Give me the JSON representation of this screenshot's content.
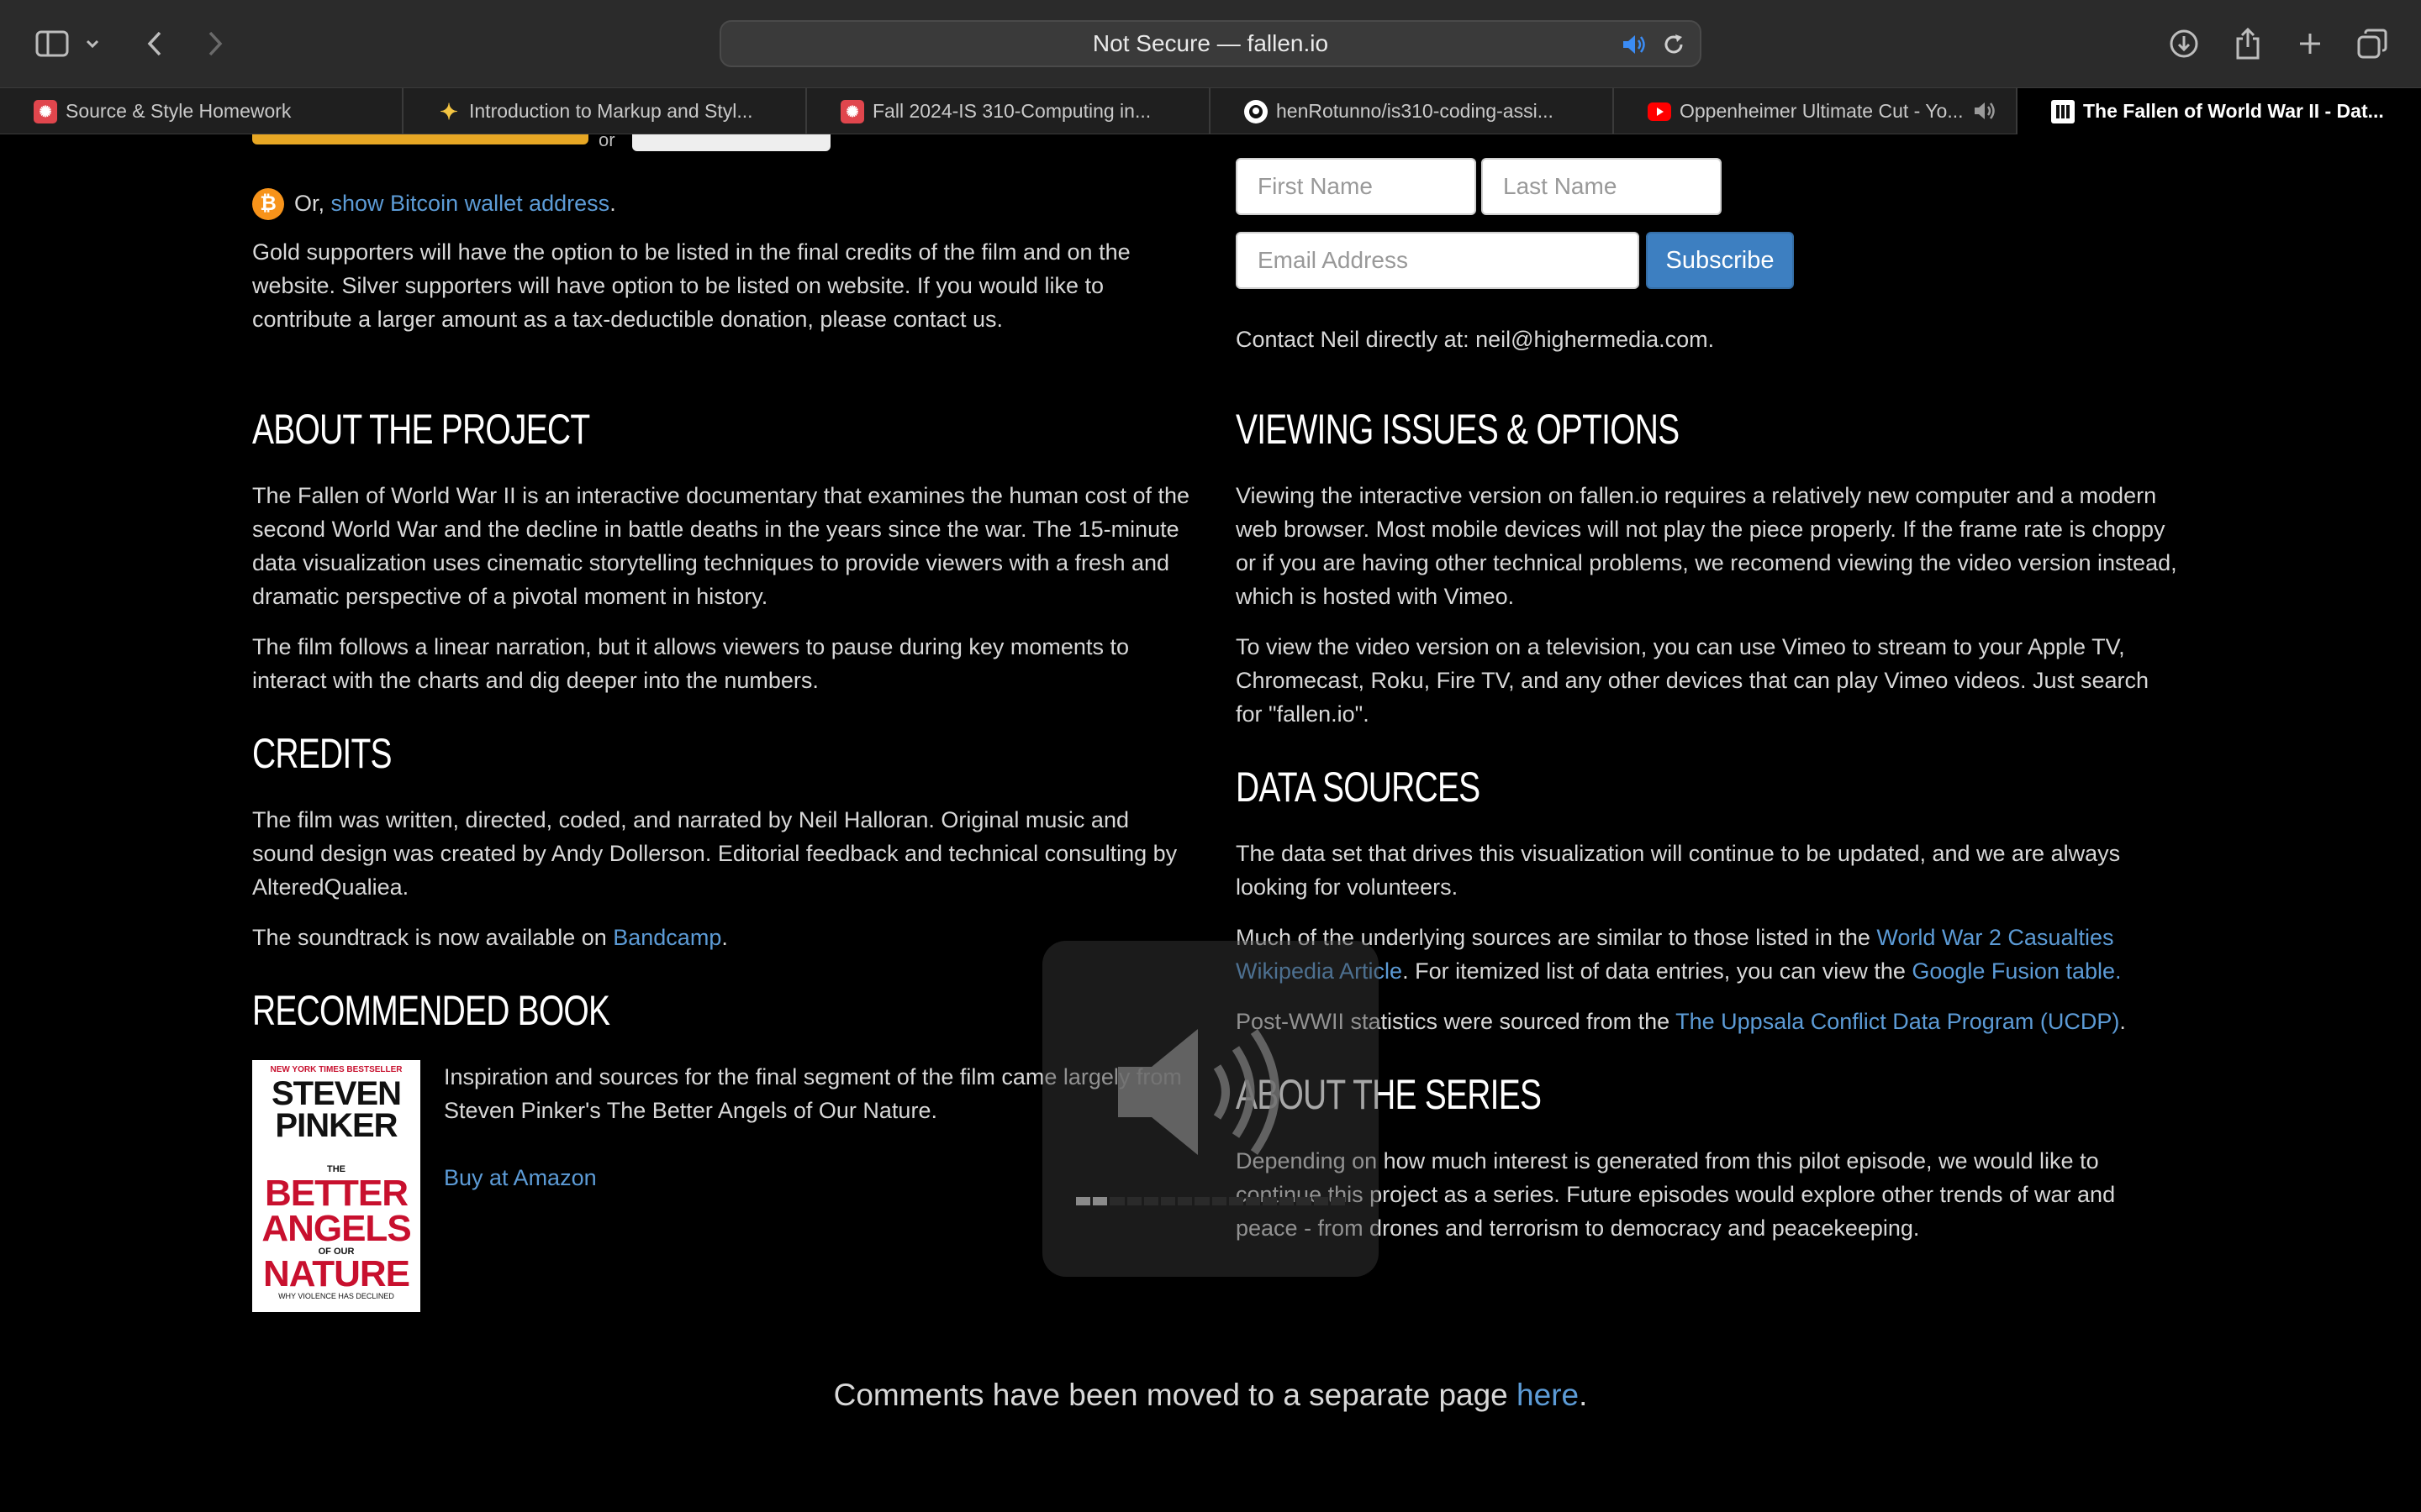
{
  "browser": {
    "address": "Not Secure — fallen.io",
    "tabs": [
      {
        "label": "Source & Style Homework",
        "icon": "canvas-icon",
        "color": "#e0464d"
      },
      {
        "label": "Introduction to Markup and Styl...",
        "icon": "sparkle-icon",
        "color": "#f4c542"
      },
      {
        "label": "Fall 2024-IS 310-Computing in...",
        "icon": "canvas-icon",
        "color": "#e0464d"
      },
      {
        "label": "henRotunno/is310-coding-assi...",
        "icon": "github-icon",
        "color": "#ffffff"
      },
      {
        "label": "Oppenheimer Ultimate Cut - Yo...",
        "icon": "youtube-icon",
        "color": "#ff0000"
      },
      {
        "label": "The Fallen of World War II - Dat...",
        "icon": "fallen-icon",
        "color": "#ffffff"
      }
    ]
  },
  "support": {
    "or_label": "or",
    "btc_prefix": "Or, ",
    "btc_link": "show Bitcoin wallet address",
    "btc_suffix": ".",
    "text": "Gold supporters will have the option to be listed in the final credits of the film and on the website. Silver supporters will have option to be listed on website. If you would like to contribute a larger amount as a tax-deductible donation, please contact us."
  },
  "newsletter": {
    "first_name_placeholder": "First Name",
    "last_name_placeholder": "Last Name",
    "email_placeholder": "Email Address",
    "subscribe_label": "Subscribe",
    "contact": "Contact Neil directly at: neil@highermedia.com."
  },
  "about": {
    "heading": "About the Project",
    "p1": "The Fallen of World War II is an interactive documentary that examines the human cost of the second World War and the decline in battle deaths in the years since the war. The 15-minute data visualization uses cinematic storytelling techniques to provide viewers with a fresh and dramatic perspective of a pivotal moment in history.",
    "p2": "The film follows a linear narration, but it allows viewers to pause during key moments to interact with the charts and dig deeper into the numbers."
  },
  "credits": {
    "heading": "Credits",
    "p1": "The film was written, directed, coded, and narrated by Neil Halloran. Original music and sound design was created by Andy Dollerson. Editorial feedback and technical consulting by AlteredQualiea.",
    "soundtrack_prefix": "The soundtrack is now available on ",
    "soundtrack_link": "Bandcamp",
    "soundtrack_suffix": "."
  },
  "book": {
    "heading": "Recommended Book",
    "cover_top": "NEW YORK TIMES BESTSELLER",
    "cover_author_1": "STEVEN",
    "cover_author_2": "PINKER",
    "cover_the": "THE",
    "cover_title_1": "BETTER",
    "cover_title_2": "ANGELS",
    "cover_of_our": "OF OUR",
    "cover_title_3": "NATURE",
    "cover_sub": "WHY VIOLENCE HAS DECLINED",
    "text": "Inspiration and sources for the final segment of the film came largely from Steven Pinker's The Better Angels of Our Nature.",
    "buy_link": "Buy at Amazon"
  },
  "viewing": {
    "heading": "Viewing Issues & Options",
    "p1": "Viewing the interactive version on fallen.io requires a relatively new computer and a modern web browser. Most mobile devices will not play the piece properly. If the frame rate is choppy or if you are having other technical problems, we recomend viewing the video version instead, which is hosted with Vimeo.",
    "p2": "To view the video version on a television, you can use Vimeo to stream to your Apple TV, Chromecast, Roku, Fire TV, and any other devices that can play Vimeo videos. Just search for \"fallen.io\"."
  },
  "data_sources": {
    "heading": "Data Sources",
    "p1": "The data set that drives this visualization will continue to be updated, and we are always looking for volunteers.",
    "p2_prefix": "Much of the underlying sources are similar to those listed in the ",
    "p2_link1": "World War 2 Casualties Wikipedia Article",
    "p2_mid": ". For itemized list of data entries, you can view the ",
    "p2_link2": "Google Fusion table.",
    "p3_prefix": "Post-WWII statistics were sourced from the ",
    "p3_link": "The Uppsala Conflict Data Program (UCDP)",
    "p3_suffix": "."
  },
  "series": {
    "heading": "About the Series",
    "p1": "Depending on how much interest is generated from this pilot episode, we would like to continue this project as a series. Future episodes would explore other trends of war and peace - from drones and terrorism to democracy and peacekeeping."
  },
  "footer": {
    "prefix": "Comments have been moved to a separate page ",
    "link": "here",
    "suffix": "."
  },
  "volume_hud": {
    "level": 0.15
  }
}
